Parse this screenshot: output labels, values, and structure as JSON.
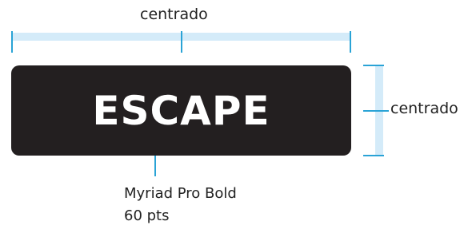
{
  "top_dimension": {
    "label": "centrado"
  },
  "side_dimension": {
    "label": "centrado"
  },
  "key": {
    "label": "ESCAPE"
  },
  "spec": {
    "font_line": "Myriad Pro Bold",
    "size_line": "60 pts"
  },
  "colors": {
    "key_background": "#231f20",
    "key_text": "#ffffff",
    "guide_band": "#d4ebf9",
    "guide_tick": "#2aa3d6",
    "annotation_text": "#222222"
  }
}
